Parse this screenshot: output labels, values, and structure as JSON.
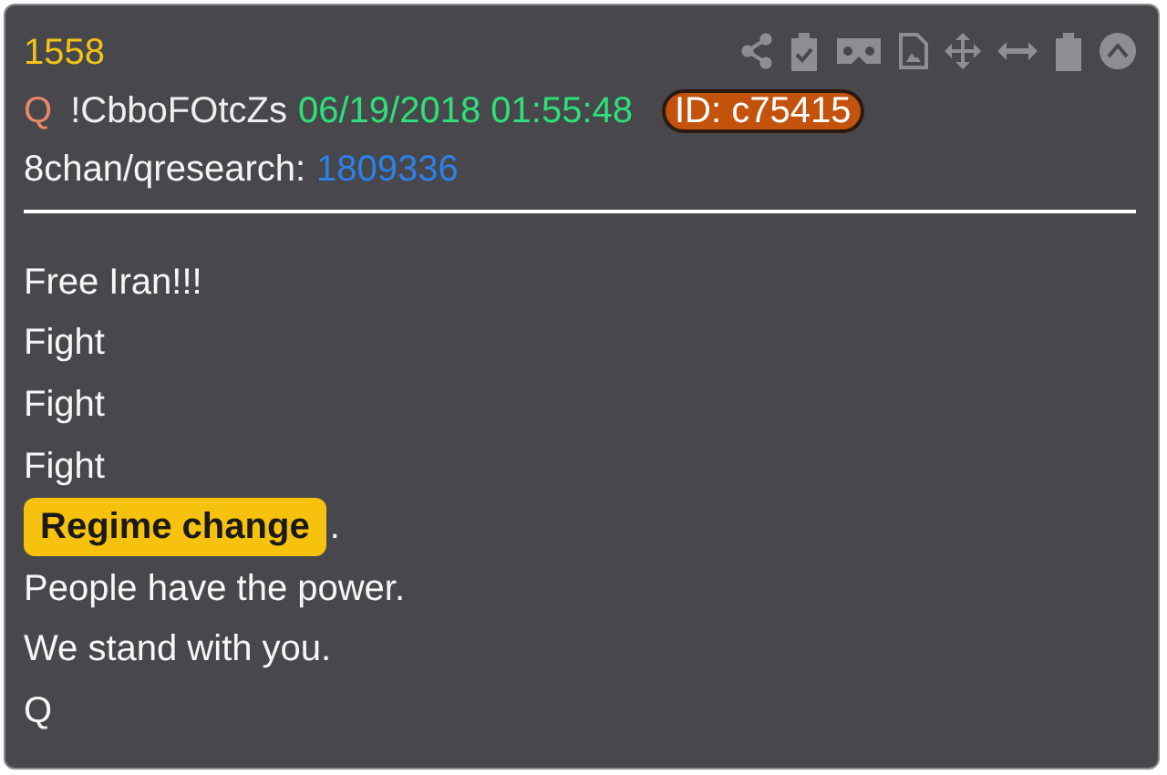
{
  "post": {
    "number": "1558",
    "name": "Q",
    "tripcode": "!CbboFOtcZs",
    "timestamp": "06/19/2018 01:55:48",
    "id_badge": "ID: c75415",
    "board": "8chan/qresearch:",
    "thread": "1809336"
  },
  "lines": [
    {
      "kind": "text",
      "text": "Free Iran!!!"
    },
    {
      "kind": "text",
      "text": "Fight"
    },
    {
      "kind": "text",
      "text": "Fight"
    },
    {
      "kind": "text",
      "text": "Fight"
    },
    {
      "kind": "highlight",
      "text": "Regime change",
      "suffix": "."
    },
    {
      "kind": "text",
      "text": "People have the power."
    },
    {
      "kind": "text",
      "text": "We stand with you."
    },
    {
      "kind": "text",
      "text": "Q"
    }
  ]
}
